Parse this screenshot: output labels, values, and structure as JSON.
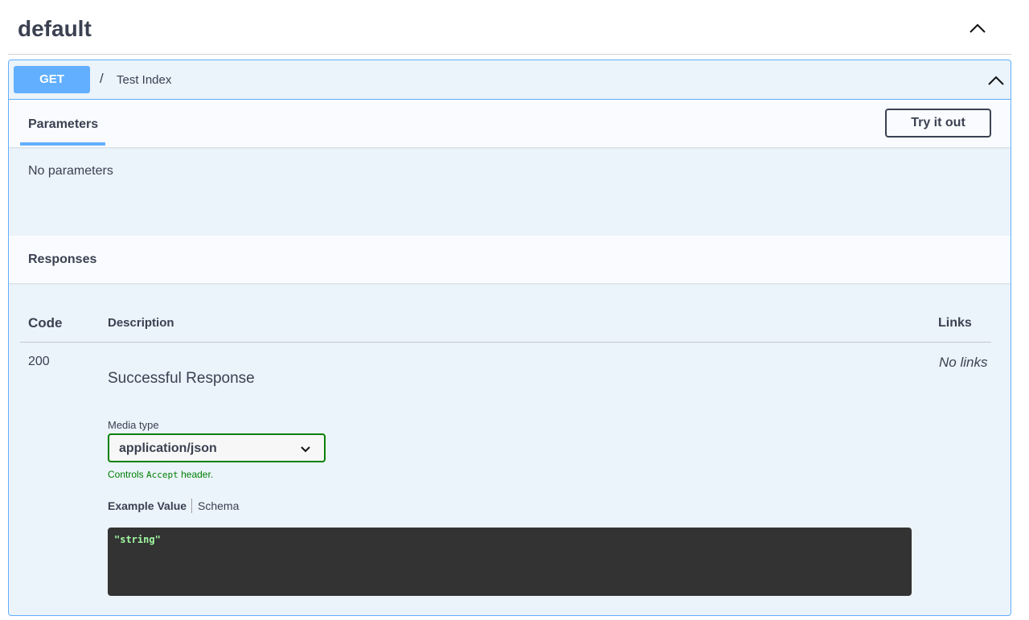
{
  "tag": {
    "title": "default"
  },
  "operation": {
    "method": "GET",
    "path": "/",
    "summary": "Test Index"
  },
  "parameters": {
    "tab_label": "Parameters",
    "try_button": "Try it out",
    "empty_text": "No parameters"
  },
  "responses": {
    "title": "Responses",
    "columns": {
      "code": "Code",
      "description": "Description",
      "links": "Links"
    },
    "rows": [
      {
        "code": "200",
        "description": "Successful Response",
        "links": "No links",
        "media_type_label": "Media type",
        "media_type": "application/json",
        "media_note_prefix": "Controls ",
        "media_note_code": "Accept",
        "media_note_suffix": " header.",
        "tab_example": "Example Value",
        "tab_schema": "Schema",
        "example": "\"string\""
      }
    ]
  },
  "colors": {
    "get_accent": "#61affe",
    "block_bg": "#ebf3fb",
    "code_bg": "#333333",
    "code_text": "#a2fca2",
    "select_border": "#008000"
  },
  "icons": {
    "tag_toggle": "chevron-up-icon",
    "summary_toggle": "chevron-up-icon",
    "select": "chevron-down-icon"
  }
}
